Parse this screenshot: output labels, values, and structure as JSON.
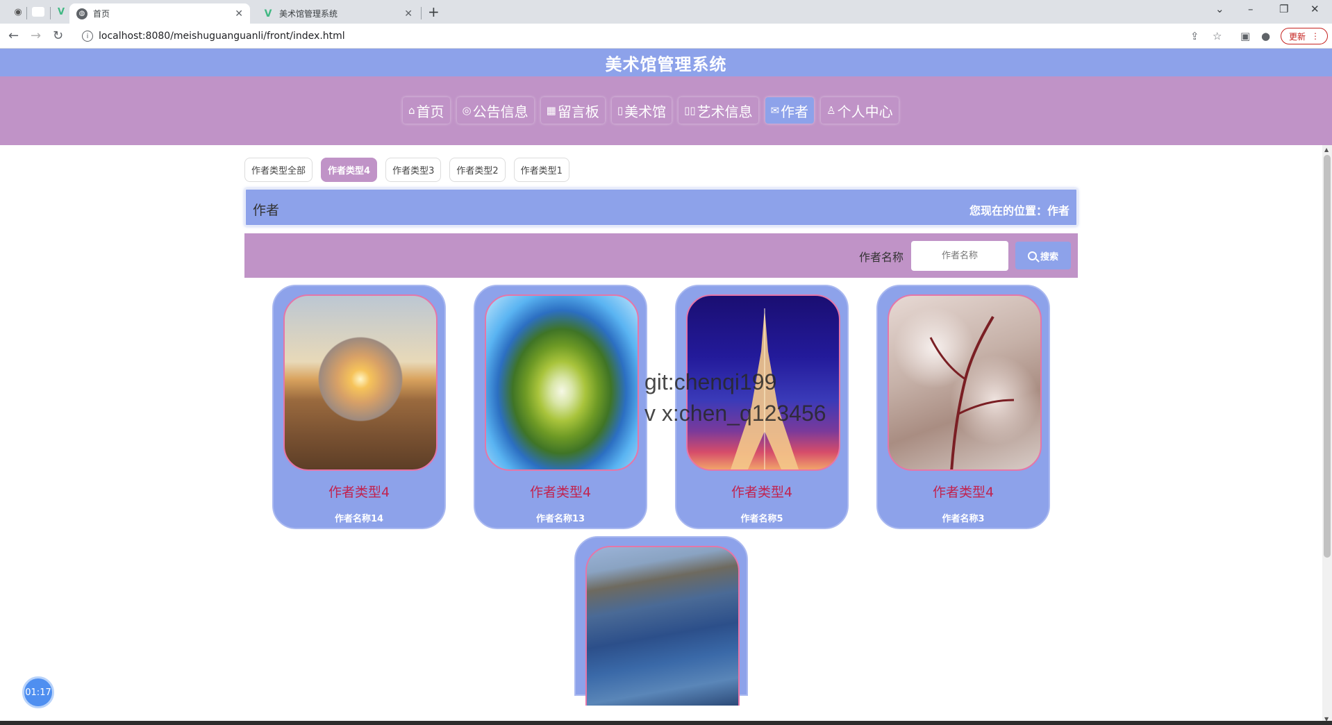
{
  "browser": {
    "tabs": [
      {
        "title": "首页",
        "favicon": "globe-icon",
        "active": true
      },
      {
        "title": "美术馆管理系统",
        "favicon": "vue-icon",
        "active": false
      }
    ],
    "url": "localhost:8080/meishuguanguanli/front/index.html",
    "update_label": "更新"
  },
  "site": {
    "title": "美术馆管理系统",
    "nav": [
      {
        "label": "首页",
        "icon": "home-icon"
      },
      {
        "label": "公告信息",
        "icon": "bell-icon"
      },
      {
        "label": "留言板",
        "icon": "grid-icon"
      },
      {
        "label": "美术馆",
        "icon": "page-icon"
      },
      {
        "label": "艺术信息",
        "icon": "book-icon"
      },
      {
        "label": "作者",
        "icon": "mail-icon",
        "active": true
      },
      {
        "label": "个人中心",
        "icon": "user-icon"
      }
    ]
  },
  "filters": [
    {
      "label": "作者类型全部",
      "active": false
    },
    {
      "label": "作者类型4",
      "active": true
    },
    {
      "label": "作者类型3",
      "active": false
    },
    {
      "label": "作者类型2",
      "active": false
    },
    {
      "label": "作者类型1",
      "active": false
    }
  ],
  "breadcrumb": {
    "title": "作者",
    "location": "您现在的位置：作者"
  },
  "search": {
    "label": "作者名称",
    "placeholder": "作者名称",
    "value": "",
    "button_label": "搜索"
  },
  "cards": [
    {
      "type": "作者类型4",
      "name": "作者名称14",
      "image": "sunset-desert"
    },
    {
      "type": "作者类型4",
      "name": "作者名称13",
      "image": "tiny-planet"
    },
    {
      "type": "作者类型4",
      "name": "作者名称5",
      "image": "eiffel-tower"
    },
    {
      "type": "作者类型4",
      "name": "作者名称3",
      "image": "blossom-branch"
    },
    {
      "type": "",
      "name": "",
      "image": "shoreline"
    }
  ],
  "watermark": [
    "git:chenqi199",
    "v x:chen_q123456"
  ],
  "timer": "01:17",
  "colors": {
    "primary_blue": "#8da2ea",
    "primary_purple": "#c093c7",
    "card_title_red": "#c1234f"
  }
}
